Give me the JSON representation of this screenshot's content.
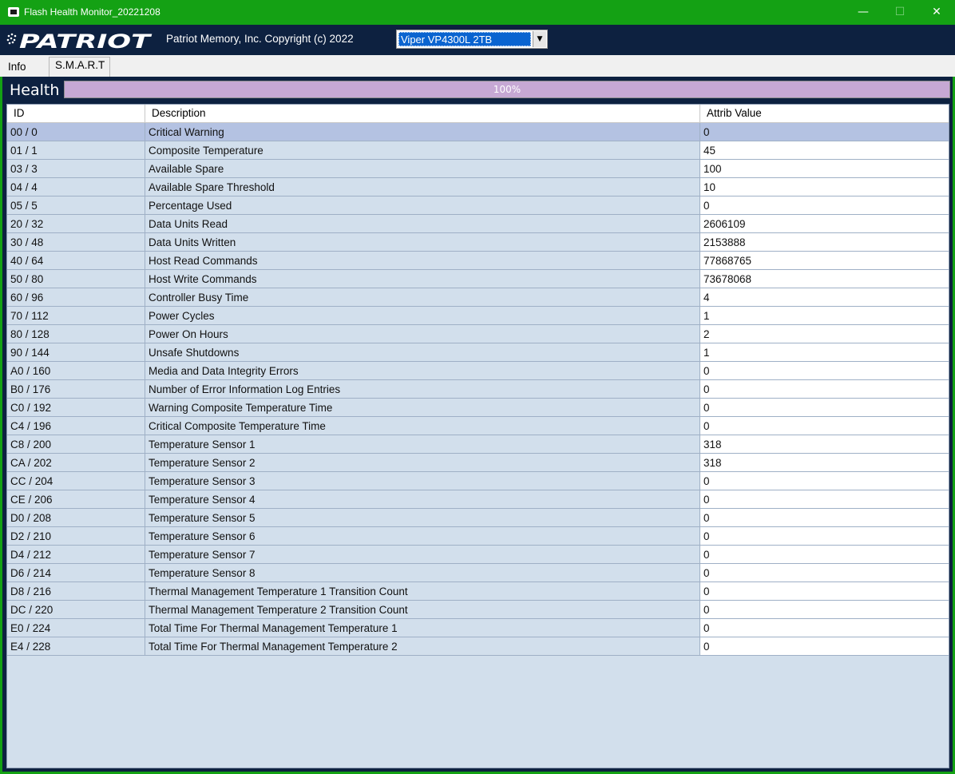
{
  "window": {
    "title": "Flash Health Monitor_20221208",
    "minimize_glyph": "—",
    "maximize_glyph": "☐",
    "close_glyph": "✕"
  },
  "header": {
    "logo_text": "PATRIOT",
    "copyright": "Patriot Memory, Inc. Copyright (c) 2022",
    "device_selected": "Viper VP4300L 2TB"
  },
  "tabs": [
    {
      "label": "Info"
    },
    {
      "label": "S.M.A.R.T"
    }
  ],
  "health": {
    "label": "Health",
    "percent_text": "100%",
    "percent": 100
  },
  "table": {
    "columns": [
      "ID",
      "Description",
      "Attrib Value"
    ],
    "rows": [
      {
        "id": "00 / 0",
        "desc": "Critical Warning",
        "val": "0"
      },
      {
        "id": "01 / 1",
        "desc": "Composite Temperature",
        "val": "45"
      },
      {
        "id": "03 / 3",
        "desc": "Available Spare",
        "val": "100"
      },
      {
        "id": "04 / 4",
        "desc": "Available Spare Threshold",
        "val": "10"
      },
      {
        "id": "05 / 5",
        "desc": "Percentage Used",
        "val": "0"
      },
      {
        "id": "20 / 32",
        "desc": "Data Units Read",
        "val": "2606109"
      },
      {
        "id": "30 / 48",
        "desc": "Data Units Written",
        "val": "2153888"
      },
      {
        "id": "40 / 64",
        "desc": "Host Read Commands",
        "val": "77868765"
      },
      {
        "id": "50 / 80",
        "desc": "Host Write Commands",
        "val": "73678068"
      },
      {
        "id": "60 / 96",
        "desc": "Controller Busy Time",
        "val": "4"
      },
      {
        "id": "70 / 112",
        "desc": "Power Cycles",
        "val": "1"
      },
      {
        "id": "80 / 128",
        "desc": "Power On Hours",
        "val": "2"
      },
      {
        "id": "90 / 144",
        "desc": "Unsafe Shutdowns",
        "val": "1"
      },
      {
        "id": "A0 / 160",
        "desc": "Media and Data Integrity Errors",
        "val": "0"
      },
      {
        "id": "B0 / 176",
        "desc": "Number of Error Information Log Entries",
        "val": "0"
      },
      {
        "id": "C0 / 192",
        "desc": "Warning Composite Temperature Time",
        "val": "0"
      },
      {
        "id": "C4 / 196",
        "desc": "Critical Composite Temperature Time",
        "val": "0"
      },
      {
        "id": "C8 / 200",
        "desc": "Temperature Sensor 1",
        "val": "318"
      },
      {
        "id": "CA / 202",
        "desc": "Temperature Sensor 2",
        "val": "318"
      },
      {
        "id": "CC / 204",
        "desc": "Temperature Sensor 3",
        "val": "0"
      },
      {
        "id": "CE / 206",
        "desc": "Temperature Sensor 4",
        "val": "0"
      },
      {
        "id": "D0 / 208",
        "desc": "Temperature Sensor 5",
        "val": "0"
      },
      {
        "id": "D2 / 210",
        "desc": "Temperature Sensor 6",
        "val": "0"
      },
      {
        "id": "D4 / 212",
        "desc": "Temperature Sensor 7",
        "val": "0"
      },
      {
        "id": "D6 / 214",
        "desc": "Temperature Sensor 8",
        "val": "0"
      },
      {
        "id": "D8 / 216",
        "desc": "Thermal Management Temperature 1 Transition Count",
        "val": "0"
      },
      {
        "id": "DC / 220",
        "desc": "Thermal Management Temperature 2 Transition Count",
        "val": "0"
      },
      {
        "id": "E0 / 224",
        "desc": "Total Time For Thermal Management Temperature 1",
        "val": "0"
      },
      {
        "id": "E4 / 228",
        "desc": "Total Time For Thermal Management Temperature 2",
        "val": "0"
      }
    ]
  },
  "colors": {
    "titlebar": "#14a114",
    "header_bg": "#0d2140",
    "health_fill": "#c6a8d4",
    "selected_row": "#b4c2e2",
    "row_bg": "#d2dfec",
    "select_highlight": "#0a64d0"
  },
  "icons": {
    "app": "patriot-app-icon",
    "dropdown": "chevron-down-icon"
  }
}
